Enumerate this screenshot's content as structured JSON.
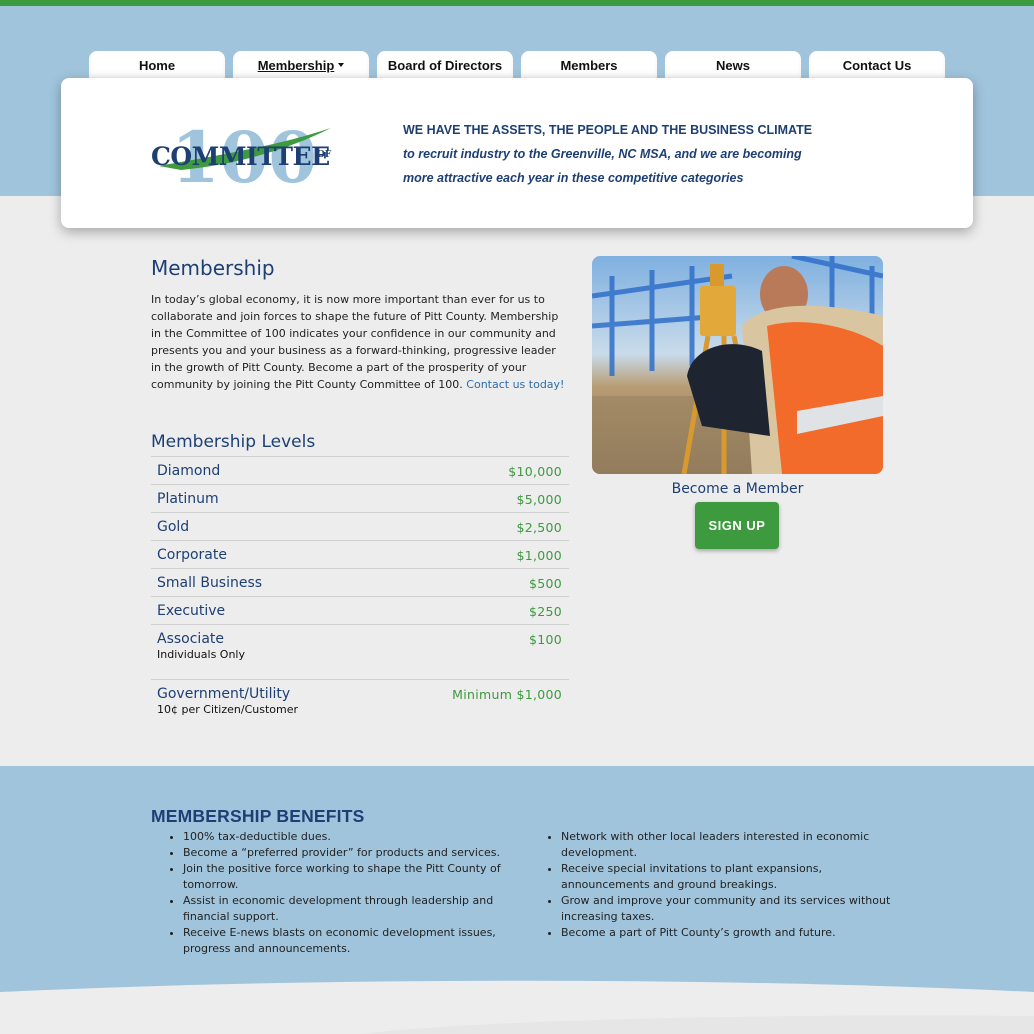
{
  "nav": {
    "tabs": [
      {
        "label": "Home"
      },
      {
        "label": "Membership"
      },
      {
        "label": "Board of Directors"
      },
      {
        "label": "Members"
      },
      {
        "label": "News"
      },
      {
        "label": "Contact Us"
      }
    ]
  },
  "header": {
    "logo_text": "COMMITTEE",
    "logo_of": "OF",
    "logo_number": "100",
    "tagline_1": "WE HAVE THE ASSETS, THE PEOPLE AND THE BUSINESS CLIMATE",
    "tagline_2": "to recruit industry to the Greenville, NC MSA, and we are becoming",
    "tagline_3": "more attractive each year in these competitive categories"
  },
  "membership": {
    "title": "Membership",
    "intro": "In today’s global economy, it is now more important than ever for us to collaborate and join forces to shape the future of Pitt County. Membership in the Committee of 100 indicates your confidence in our community and presents you and your business as a forward-thinking, progressive leader in the growth of Pitt County. Become a part of the prosperity of your community by joining the Pitt County Committee of 100.",
    "contact_link": "Contact us today!",
    "levels_title": "Membership Levels",
    "levels": [
      {
        "name": "Diamond",
        "price": "$10,000",
        "sub": ""
      },
      {
        "name": "Platinum",
        "price": "$5,000",
        "sub": ""
      },
      {
        "name": "Gold",
        "price": "$2,500",
        "sub": ""
      },
      {
        "name": "Corporate",
        "price": "$1,000",
        "sub": ""
      },
      {
        "name": "Small Business",
        "price": "$500",
        "sub": ""
      },
      {
        "name": "Executive",
        "price": "$250",
        "sub": ""
      },
      {
        "name": "Associate",
        "price": "$100",
        "sub": "Individuals Only"
      },
      {
        "name": "Government/Utility",
        "price": "Minimum $1,000",
        "sub": "10¢ per Citizen/Customer"
      }
    ]
  },
  "sidebar": {
    "become_label": "Become a Member",
    "signup_label": "SIGN UP"
  },
  "benefits": {
    "title": "MEMBERSHIP BENEFITS",
    "left": [
      "100% tax-deductible dues.",
      "Become a “preferred provider” for products and services.",
      "Join the positive force working to shape the Pitt County of tomorrow.",
      "Assist in economic development through leadership and financial support.",
      "Receive E-news blasts on economic development issues, progress and announcements."
    ],
    "right": [
      "Network with other local leaders interested in economic development.",
      "Receive special invitations to plant expansions, announcements and ground breakings.",
      "Grow and improve your community and its services without increasing taxes.",
      "Become a part of Pitt County’s growth and future."
    ]
  },
  "colors": {
    "brand_green": "#3d9a3f",
    "brand_navy": "#1d3f74",
    "band_blue": "#a0c4dc"
  }
}
